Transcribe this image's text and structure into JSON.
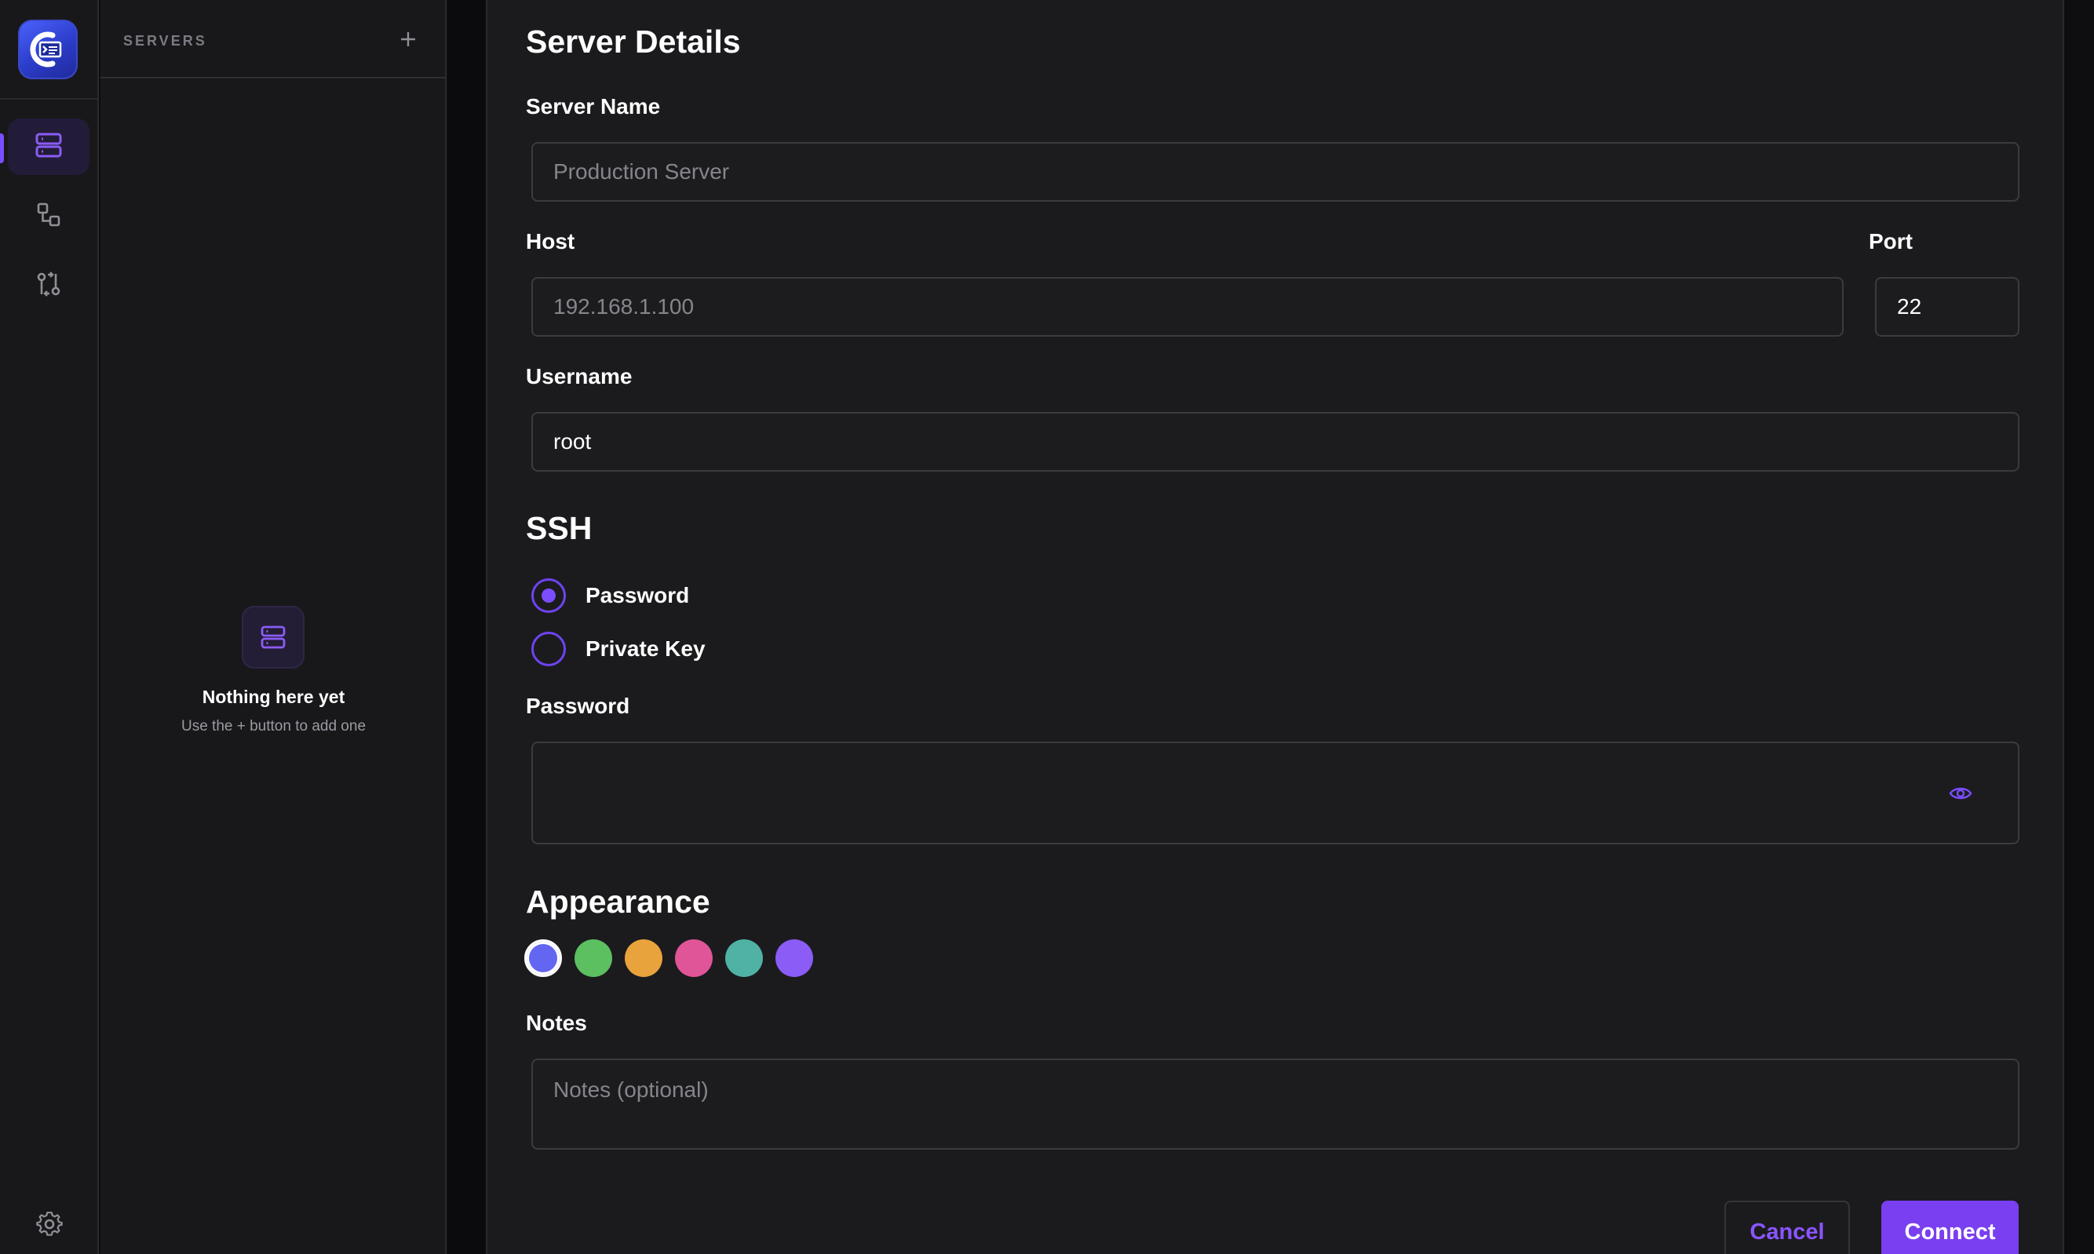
{
  "sidebar": {
    "nav": [
      {
        "icon": "servers-icon",
        "active": true
      },
      {
        "icon": "connections-icon",
        "active": false
      },
      {
        "icon": "transfer-icon",
        "active": false
      }
    ],
    "settings_icon": "gear-icon"
  },
  "servers_panel": {
    "title": "SERVERS",
    "add_label": "+",
    "empty_title": "Nothing here yet",
    "empty_subtitle": "Use the + button to add one"
  },
  "form": {
    "heading": "Server Details",
    "server_name": {
      "label": "Server Name",
      "placeholder": "Production Server",
      "value": ""
    },
    "host": {
      "label": "Host",
      "placeholder": "192.168.1.100",
      "value": ""
    },
    "port": {
      "label": "Port",
      "value": "22"
    },
    "username": {
      "label": "Username",
      "value": "root"
    },
    "ssh": {
      "heading": "SSH",
      "options": [
        {
          "label": "Password",
          "selected": true
        },
        {
          "label": "Private Key",
          "selected": false
        }
      ]
    },
    "password": {
      "label": "Password",
      "value": "",
      "toggle_icon": "eye-icon"
    },
    "appearance": {
      "heading": "Appearance",
      "colors": [
        "#6366f1",
        "#5cbf60",
        "#e8a33d",
        "#e05597",
        "#4fb2a4",
        "#8b5cf6"
      ],
      "selected_index": 0
    },
    "notes": {
      "label": "Notes",
      "placeholder": "Notes (optional)",
      "value": ""
    },
    "buttons": {
      "cancel": "Cancel",
      "connect": "Connect"
    }
  },
  "theme": {
    "accent": "#7a3ff0",
    "background": "#1b1b1e",
    "panel": "#18181b"
  }
}
